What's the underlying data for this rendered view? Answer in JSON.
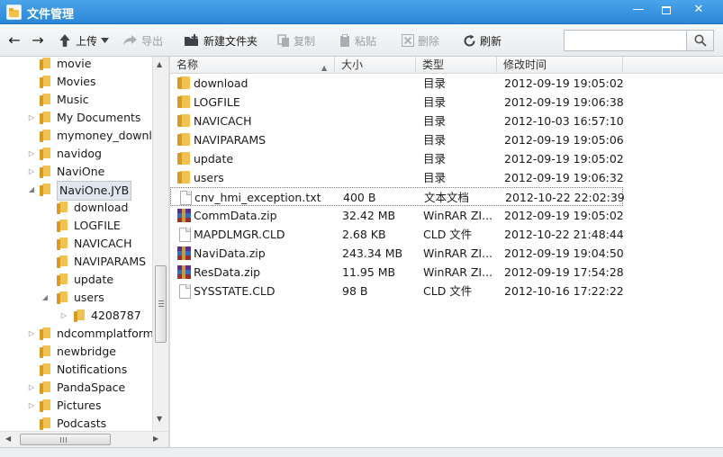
{
  "window": {
    "title": "文件管理",
    "minimize_glyph": "—",
    "close_glyph": "✕"
  },
  "toolbar": {
    "back_glyph": "←",
    "forward_glyph": "→",
    "up_label": "上传",
    "export_label": "导出",
    "new_folder_label": "新建文件夹",
    "copy_label": "复制",
    "paste_label": "粘贴",
    "delete_label": "删除",
    "refresh_label": "刷新",
    "search": {
      "value": "",
      "placeholder": ""
    }
  },
  "tree": {
    "items": [
      {
        "label": "movie",
        "expander": ""
      },
      {
        "label": "Movies",
        "expander": ""
      },
      {
        "label": "Music",
        "expander": ""
      },
      {
        "label": "My Documents",
        "expander": "▷"
      },
      {
        "label": "mymoney_download",
        "expander": ""
      },
      {
        "label": "navidog",
        "expander": "▷"
      },
      {
        "label": "NaviOne",
        "expander": "▷"
      },
      {
        "label": "NaviOne.JYB",
        "expander": "◢",
        "selected": true
      },
      {
        "label": "download",
        "expander": ""
      },
      {
        "label": "LOGFILE",
        "expander": ""
      },
      {
        "label": "NAVICACH",
        "expander": ""
      },
      {
        "label": "NAVIPARAMS",
        "expander": ""
      },
      {
        "label": "update",
        "expander": ""
      },
      {
        "label": "users",
        "expander": "◢"
      },
      {
        "label": "4208787",
        "expander": "▷"
      },
      {
        "label": "ndcommplatform",
        "expander": "▷"
      },
      {
        "label": "newbridge",
        "expander": ""
      },
      {
        "label": "Notifications",
        "expander": ""
      },
      {
        "label": "PandaSpace",
        "expander": "▷"
      },
      {
        "label": "Pictures",
        "expander": "▷"
      },
      {
        "label": "Podcasts",
        "expander": ""
      }
    ]
  },
  "columns": {
    "name": "名称",
    "size": "大小",
    "type": "类型",
    "modified": "修改时间"
  },
  "files": [
    {
      "name": "download",
      "size": "",
      "type": "目录",
      "modified": "2012-09-19 19:05:02",
      "icon": "folder-icon"
    },
    {
      "name": "LOGFILE",
      "size": "",
      "type": "目录",
      "modified": "2012-09-19 19:06:38",
      "icon": "folder-icon"
    },
    {
      "name": "NAVICACH",
      "size": "",
      "type": "目录",
      "modified": "2012-10-03 16:57:10",
      "icon": "folder-icon"
    },
    {
      "name": "NAVIPARAMS",
      "size": "",
      "type": "目录",
      "modified": "2012-09-19 19:05:06",
      "icon": "folder-icon"
    },
    {
      "name": "update",
      "size": "",
      "type": "目录",
      "modified": "2012-09-19 19:05:02",
      "icon": "folder-icon"
    },
    {
      "name": "users",
      "size": "",
      "type": "目录",
      "modified": "2012-09-19 19:06:32",
      "icon": "folder-icon"
    },
    {
      "name": "cnv_hmi_exception.txt",
      "size": "400 B",
      "type": "文本文档",
      "modified": "2012-10-22 22:02:39",
      "icon": "text-file-icon",
      "focused": true
    },
    {
      "name": "CommData.zip",
      "size": "32.42 MB",
      "type": "WinRAR ZI...",
      "modified": "2012-09-19 19:05:02",
      "icon": "winrar-archive-icon"
    },
    {
      "name": "MAPDLMGR.CLD",
      "size": "2.68 KB",
      "type": "CLD 文件",
      "modified": "2012-10-22 21:48:44",
      "icon": "file-icon"
    },
    {
      "name": "NaviData.zip",
      "size": "243.34 MB",
      "type": "WinRAR ZI...",
      "modified": "2012-09-19 19:04:50",
      "icon": "winrar-archive-icon"
    },
    {
      "name": "ResData.zip",
      "size": "11.95 MB",
      "type": "WinRAR ZI...",
      "modified": "2012-09-19 17:54:28",
      "icon": "winrar-archive-icon"
    },
    {
      "name": "SYSSTATE.CLD",
      "size": "98 B",
      "type": "CLD 文件",
      "modified": "2012-10-16 17:22:22",
      "icon": "file-icon"
    }
  ]
}
